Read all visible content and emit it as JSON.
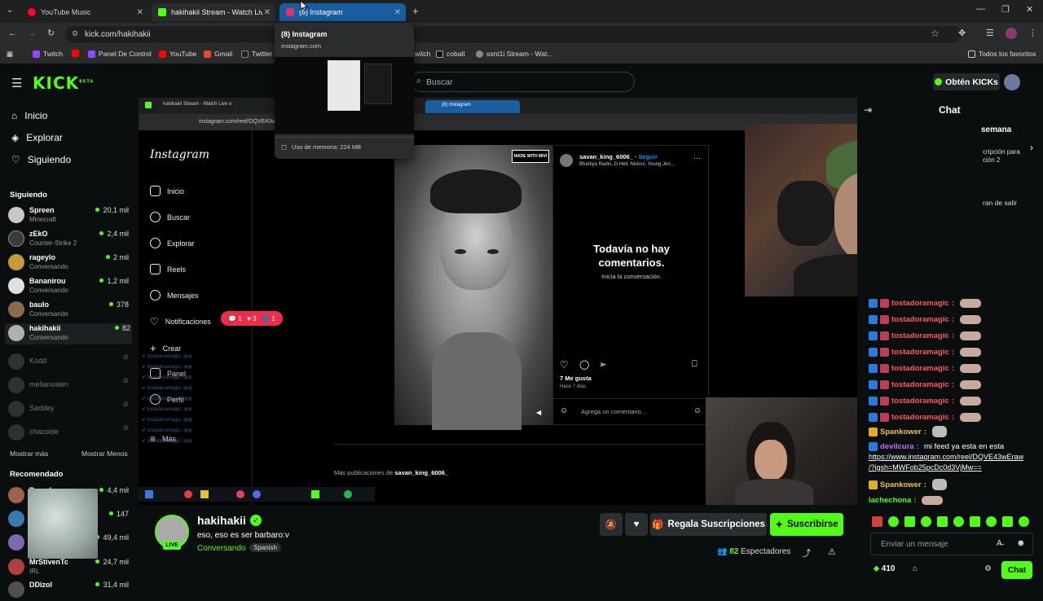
{
  "browser": {
    "tabs": [
      {
        "title": "YouTube Music",
        "color": "#ff0033"
      },
      {
        "title": "hakihakii Stream - Watch Live o",
        "color": "#53fc18"
      },
      {
        "title": "(8) Instagram",
        "color": "#e1306c"
      }
    ],
    "url": "kick.com/hakihakii",
    "bookmarks": [
      "Twitch",
      "Panel De Control",
      "YouTube",
      "Gmail",
      "Twitter",
      "witch",
      "cobalt",
      "ssnt1i Stream - Wat..."
    ],
    "bookmarks_all": "Todos los favoritos"
  },
  "tab_preview": {
    "title": "(8) Instagram",
    "domain": "instagram.com",
    "memory": "Uso de memoria: 224 MB"
  },
  "kick": {
    "logo": "KICK",
    "beta": "BETA",
    "search_placeholder": "Buscar",
    "get_kicks": "Obtén KICKs"
  },
  "sidebar": {
    "nav": [
      {
        "label": "Inicio",
        "icon": "home-icon"
      },
      {
        "label": "Explorar",
        "icon": "compass-icon"
      },
      {
        "label": "Siguiendo",
        "icon": "heart-icon"
      }
    ],
    "following_title": "Siguiendo",
    "following": [
      {
        "name": "Spreen",
        "sub": "Minecraft",
        "viewers": "20,1 mil",
        "color": "#c8c8c8"
      },
      {
        "name": "zEkO",
        "sub": "Counter-Strike 2",
        "viewers": "2,4 mil",
        "color": "#3a3a3a"
      },
      {
        "name": "rageylo",
        "sub": "Conversando",
        "viewers": "2 mil",
        "color": "#c89a3a"
      },
      {
        "name": "Bananirou",
        "sub": "Conversando",
        "viewers": "1,2 mil",
        "color": "#e0e0e0"
      },
      {
        "name": "baulo",
        "sub": "Conversando",
        "viewers": "378",
        "color": "#8a6a4a"
      },
      {
        "name": "hakihakii",
        "sub": "Conversando",
        "viewers": "82",
        "color": "#b0b0b0"
      }
    ],
    "offline": [
      {
        "name": "Kodd"
      },
      {
        "name": "melianvalen"
      },
      {
        "name": "Saddey"
      },
      {
        "name": "chacoide"
      }
    ],
    "show_more": "Mostrar más",
    "show_less": "Mostrar Menos",
    "recommended_title": "Recomendado",
    "recommended": [
      {
        "name": "Pssrck",
        "viewers": "4,4 mil",
        "color": "#a06050"
      },
      {
        "name": "",
        "viewers": "147",
        "color": "#3a7ab0"
      },
      {
        "name": "",
        "viewers": "49,4 mil",
        "color": "#7a6ab0"
      },
      {
        "name": "MrStivenTc",
        "sub": "IRL",
        "viewers": "24,7 mil",
        "color": "#b04040"
      },
      {
        "name": "DDizol",
        "viewers": "31,4 mil",
        "color": "#505050"
      }
    ]
  },
  "stream_content": {
    "ig_brand": "Instagram",
    "ig_nav": [
      "Inicio",
      "Buscar",
      "Explorar",
      "Reels",
      "Mensajes",
      "Notificaciones",
      "Crear",
      "Panel",
      "Perfil",
      "Más"
    ],
    "notif_pill": {
      "comments": "1",
      "likes": "3",
      "follows": "1"
    },
    "post_user": "savan_king_6006_",
    "follow": "Seguir",
    "post_audio": "Bhartiya Radio, D Hell, Nickox, Young Jeri...",
    "no_comments": "Todavía no hay comentarios.",
    "start_conv": "Inicia la conversación.",
    "likes": "7 Me gusta",
    "ago": "Hace 7 días",
    "add_comment": "Agrega un comentario...",
    "more_posts_prefix": "Más publicaciones de",
    "more_posts_user": "savan_king_6006_",
    "watermark": "MADE WITH MIVI"
  },
  "streamer": {
    "name": "hakihakii",
    "title": "eso, eso es ser barbaro:v",
    "category": "Conversando",
    "language": "Spanish",
    "live": "LIVE",
    "subscribe_gift": "Regala Suscripciones",
    "subscribe": "Suscribirse",
    "viewers": "82",
    "viewers_label": "Espectadores"
  },
  "chat": {
    "title": "Chat",
    "pinned_1": "semana",
    "pinned_2": "cripción para",
    "pinned_3": "ción 2",
    "pinned_4": "ran de salir",
    "messages": [
      {
        "user": "tostadoramagic",
        "color": "#ff5a5a"
      },
      {
        "user": "tostadoramagic",
        "color": "#ff5a5a"
      },
      {
        "user": "tostadoramagic",
        "color": "#ff5a5a"
      },
      {
        "user": "tostadoramagic",
        "color": "#ff5a5a"
      },
      {
        "user": "tostadoramagic",
        "color": "#ff5a5a"
      },
      {
        "user": "tostadoramagic",
        "color": "#ff5a5a"
      },
      {
        "user": "tostadoramagic",
        "color": "#ff5a5a"
      },
      {
        "user": "tostadoramagic",
        "color": "#ff5a5a"
      }
    ],
    "spank1": "Spankower",
    "devil_user": "devilcura",
    "devil_text": "mi feed ya esta en esta",
    "link_1": "https://www.instagram.com/reel/DQVE43wEraw",
    "link_2": "/?igsh=MWFob25pcDc0d3VjMw==",
    "spank2": "Spankower",
    "lachechona": "lachechona",
    "input_placeholder": "Enviar un mensaje",
    "points": "410",
    "send": "Chat"
  }
}
